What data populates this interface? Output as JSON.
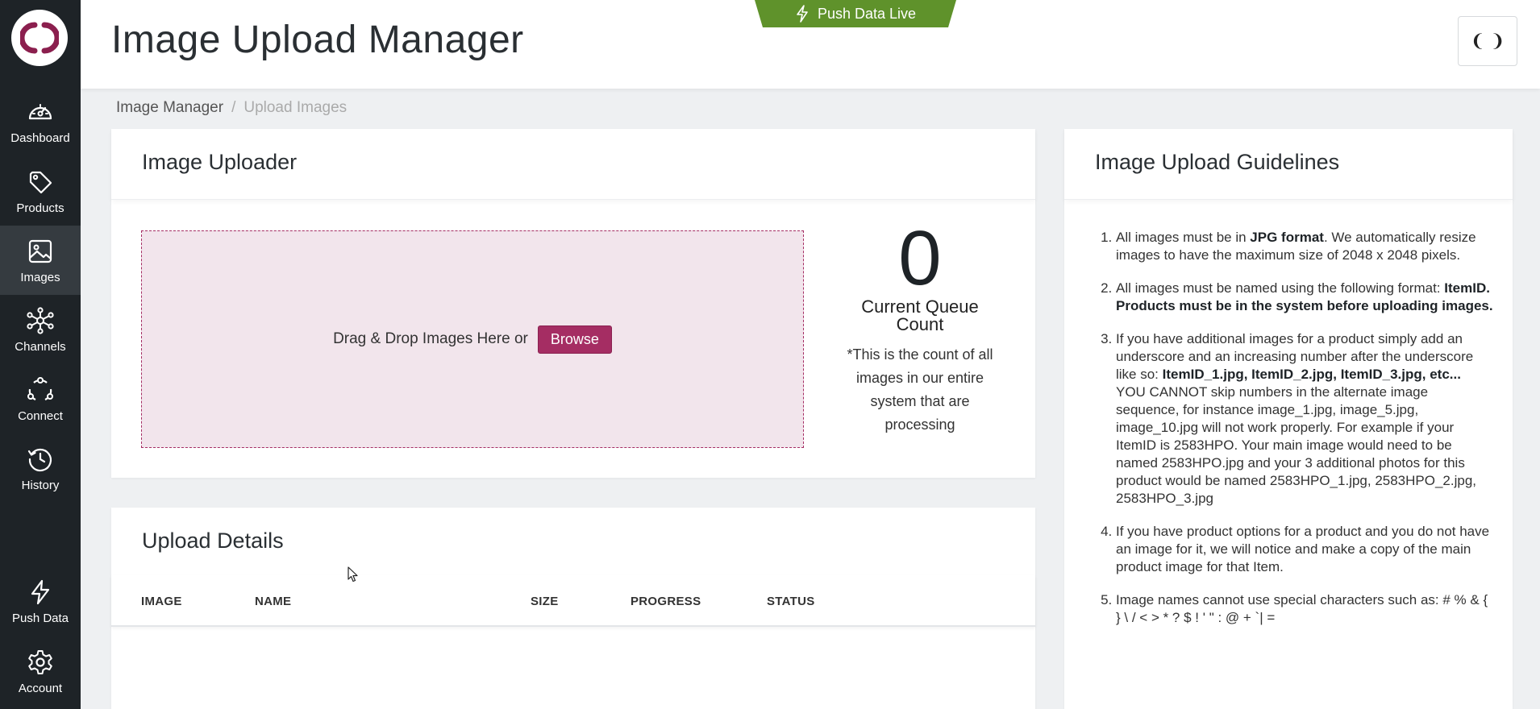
{
  "app": {
    "page_title": "Image Upload Manager",
    "push_live_label": "Push Data Live",
    "header_button_label": "❨ ❩"
  },
  "sidebar": {
    "items": [
      {
        "label": "Dashboard",
        "icon": "dashboard-gauge-icon"
      },
      {
        "label": "Products",
        "icon": "tag-icon"
      },
      {
        "label": "Images",
        "icon": "image-icon",
        "active": true
      },
      {
        "label": "Channels",
        "icon": "network-icon"
      },
      {
        "label": "Connect",
        "icon": "connect-icon"
      },
      {
        "label": "History",
        "icon": "history-icon"
      },
      {
        "label": "Push Data",
        "icon": "lightning-icon"
      },
      {
        "label": "Account",
        "icon": "gear-icon"
      }
    ]
  },
  "breadcrumb": {
    "parent": "Image Manager",
    "separator": "/",
    "current": "Upload Images"
  },
  "uploader": {
    "title": "Image Uploader",
    "drop_text": "Drag & Drop Images Here or",
    "browse_label": "Browse",
    "queue_count": "0",
    "queue_label": "Current Queue Count",
    "queue_note": "*This is the count of all images in our entire system that are processing"
  },
  "upload_details": {
    "title": "Upload Details",
    "columns": [
      "IMAGE",
      "NAME",
      "SIZE",
      "PROGRESS",
      "STATUS"
    ]
  },
  "guidelines": {
    "title": "Image Upload Guidelines",
    "items": [
      {
        "parts": [
          {
            "t": "All images must be in "
          },
          {
            "t": "JPG format",
            "b": true
          },
          {
            "t": ". We automatically resize images to have the maximum size of 2048 x 2048 pixels."
          }
        ]
      },
      {
        "parts": [
          {
            "t": "All images must be named using the following format: "
          },
          {
            "t": "ItemID. Products must be in the system before uploading images.",
            "b": true
          }
        ]
      },
      {
        "parts": [
          {
            "t": "If you have additional images for a product simply add an underscore and an increasing number after the underscore like so: "
          },
          {
            "t": "ItemID_1.jpg, ItemID_2.jpg, ItemID_3.jpg, etc...",
            "b": true
          },
          {
            "t": " YOU CANNOT skip numbers in the alternate image sequence, for instance image_1.jpg, image_5.jpg, image_10.jpg will not work properly. For example if your ItemID is 2583HPO. Your main image would need to be named 2583HPO.jpg and your 3 additional photos for this product would be named 2583HPO_1.jpg, 2583HPO_2.jpg, 2583HPO_3.jpg"
          }
        ]
      },
      {
        "parts": [
          {
            "t": "If you have product options for a product and you do not have an image for it, we will notice and make a copy of the main product image for that Item."
          }
        ]
      },
      {
        "parts": [
          {
            "t": "Image names cannot use special characters such as: # % & { } \\ / < > * ? $ ! ' \" : @ + `| ="
          }
        ]
      }
    ]
  },
  "colors": {
    "sidebar_bg": "#1e2327",
    "accent": "#a52d63",
    "push_green": "#5f922b"
  }
}
